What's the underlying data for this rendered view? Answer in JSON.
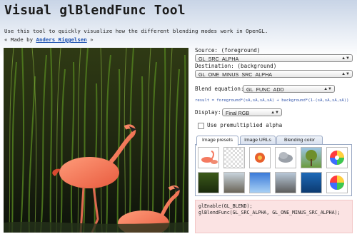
{
  "header": {
    "title": "Visual glBlendFunc Tool",
    "intro": "Use this tool to quickly visualize how the different blending modes work in OpenGL.",
    "credit_prefix": "« Made by ",
    "credit_name": "Anders Riggelsen",
    "credit_suffix": " »"
  },
  "controls": {
    "source_label": "Source: (foreground)",
    "source_value": "GL_SRC_ALPHA",
    "destination_label": "Destination: (background)",
    "destination_value": "GL_ONE_MINUS_SRC_ALPHA",
    "equation_label": "Blend equation:",
    "equation_value": "GL_FUNC_ADD",
    "formula": "result = foreground*(sA,sA,sA,sA) + background*(1-(sA,sA,sA,sA))",
    "display_label": "Display:",
    "display_value": "Final RGB",
    "premultiplied_label": "Use premultiplied alpha"
  },
  "tabs": [
    "Image presets",
    "Image URLs",
    "Blending color"
  ],
  "thumbnails": [
    "flamingo-thumbnail",
    "transparent-pattern-thumbnail",
    "red-flower-thumbnail",
    "gray-cloud-thumbnail",
    "tree-thumbnail",
    "color-wheel-thumbnail",
    "grass-thumbnail",
    "rocks-thumbnail",
    "blue-sky-thumbnail",
    "road-thumbnail",
    "ocean-thumbnail",
    "color-wheel-2-thumbnail"
  ],
  "code": {
    "line1": "glEnable(GL_BLEND);",
    "line2": "glBlendFunc(GL_SRC_ALPHA, GL_ONE_MINUS_SRC_ALPHA);"
  },
  "colors": {
    "link": "#1a4fb0",
    "code_bg": "#fbe3e3",
    "formula": "#3355aa"
  }
}
